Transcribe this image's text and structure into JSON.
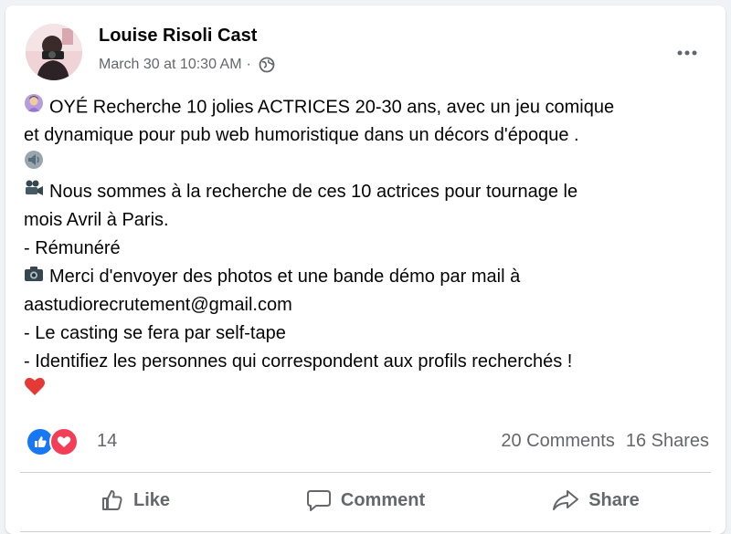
{
  "post": {
    "author": "Louise Risoli Cast",
    "timestamp": "March 30 at 10:30 AM",
    "separator": "·",
    "privacy_icon": "globe-icon",
    "more_icon": "more-options-icon",
    "lines": [
      {
        "emoji": "woman-raising-hand",
        "text": "OYÉ Recherche 10 jolies ACTRICES 20-30 ans, avec un jeu comique"
      },
      {
        "emoji": "",
        "text": "et dynamique pour pub web humoristique dans un décors d'époque ."
      },
      {
        "emoji": "speaker",
        "text": ""
      },
      {
        "emoji": "movie-camera",
        "text": "Nous sommes à la recherche de ces 10 actrices pour tournage le"
      },
      {
        "emoji": "",
        "text": "mois Avril à Paris."
      },
      {
        "emoji": "",
        "text": "- Rémunéré"
      },
      {
        "emoji": "camera",
        "text": "Merci d'envoyer des photos et une bande démo par mail à"
      },
      {
        "emoji": "",
        "text": "aastudiorecrutement@gmail.com"
      },
      {
        "emoji": "",
        "text": "- Le casting se fera par self-tape"
      },
      {
        "emoji": "",
        "text": "- Identifiez les personnes qui correspondent aux profils recherchés !"
      },
      {
        "emoji": "red-heart",
        "text": ""
      }
    ]
  },
  "reactions": {
    "types": [
      "like",
      "love"
    ],
    "count": "14",
    "comments": "20 Comments",
    "shares": "16 Shares"
  },
  "actions": {
    "like": "Like",
    "comment": "Comment",
    "share": "Share"
  },
  "colors": {
    "brand": "#1877f2",
    "love": "#f33e58",
    "muted_text": "#65676b",
    "background": "#f0f2f5"
  }
}
